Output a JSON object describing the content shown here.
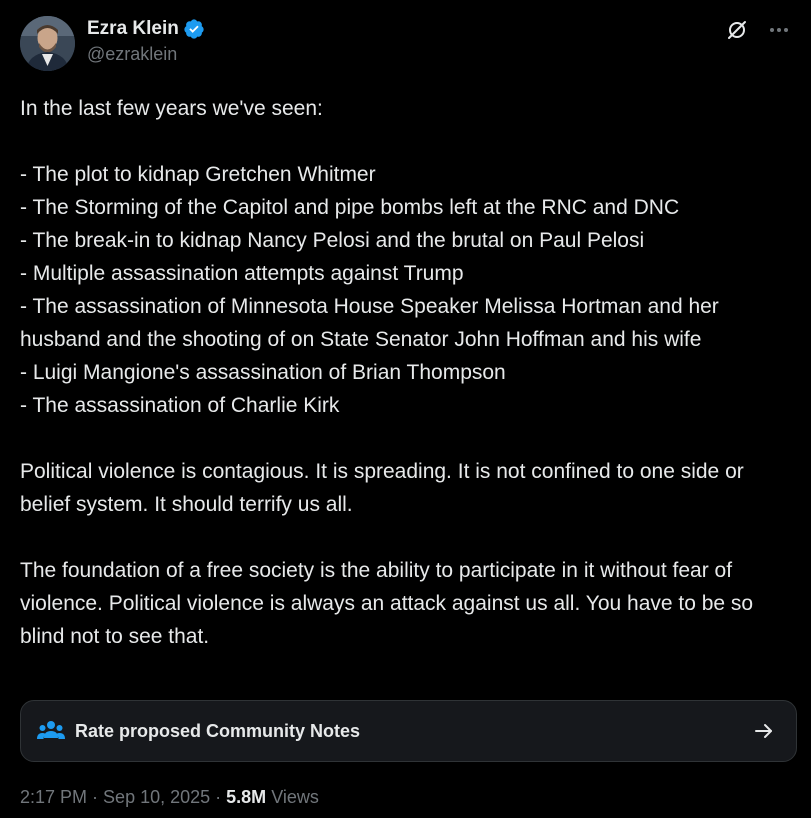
{
  "author": {
    "display_name": "Ezra Klein",
    "handle": "@ezraklein",
    "verified": true
  },
  "header_actions": {
    "grok_icon": "grok-slash-circle-icon",
    "more_icon": "more-horizontal-icon"
  },
  "tweet": {
    "text": "In the last few years we've seen:\n\n- The plot to kidnap Gretchen Whitmer\n- The Storming of the Capitol and pipe bombs left at the RNC and DNC\n- The break-in to kidnap Nancy Pelosi and the brutal on Paul Pelosi\n- Multiple assassination attempts against Trump\n- The assassination of Minnesota House Speaker Melissa Hortman and her husband and the shooting of on State Senator John Hoffman and his wife\n- Luigi Mangione's assassination of Brian Thompson\n- The assassination of Charlie Kirk\n\nPolitical violence is contagious. It is spreading. It is not confined to one side or belief system. It should terrify us all.\n\nThe foundation of a free society is the ability to participate in it without fear of violence. Political violence is always an attack against us all. You have to be so blind not to see that."
  },
  "community_notes": {
    "label": "Rate proposed Community Notes",
    "icon": "people-group-icon",
    "arrow_icon": "arrow-right-icon"
  },
  "meta": {
    "time": "2:17 PM",
    "sep1": " · ",
    "date": "Sep 10, 2025",
    "sep2": " · ",
    "views_count": "5.8M",
    "views_label": " Views"
  },
  "colors": {
    "background": "#000000",
    "text_primary": "#e7e9ea",
    "text_secondary": "#71767b",
    "verified_blue": "#1d9bf0",
    "card_background": "#16181c",
    "card_border": "#2f3336"
  }
}
